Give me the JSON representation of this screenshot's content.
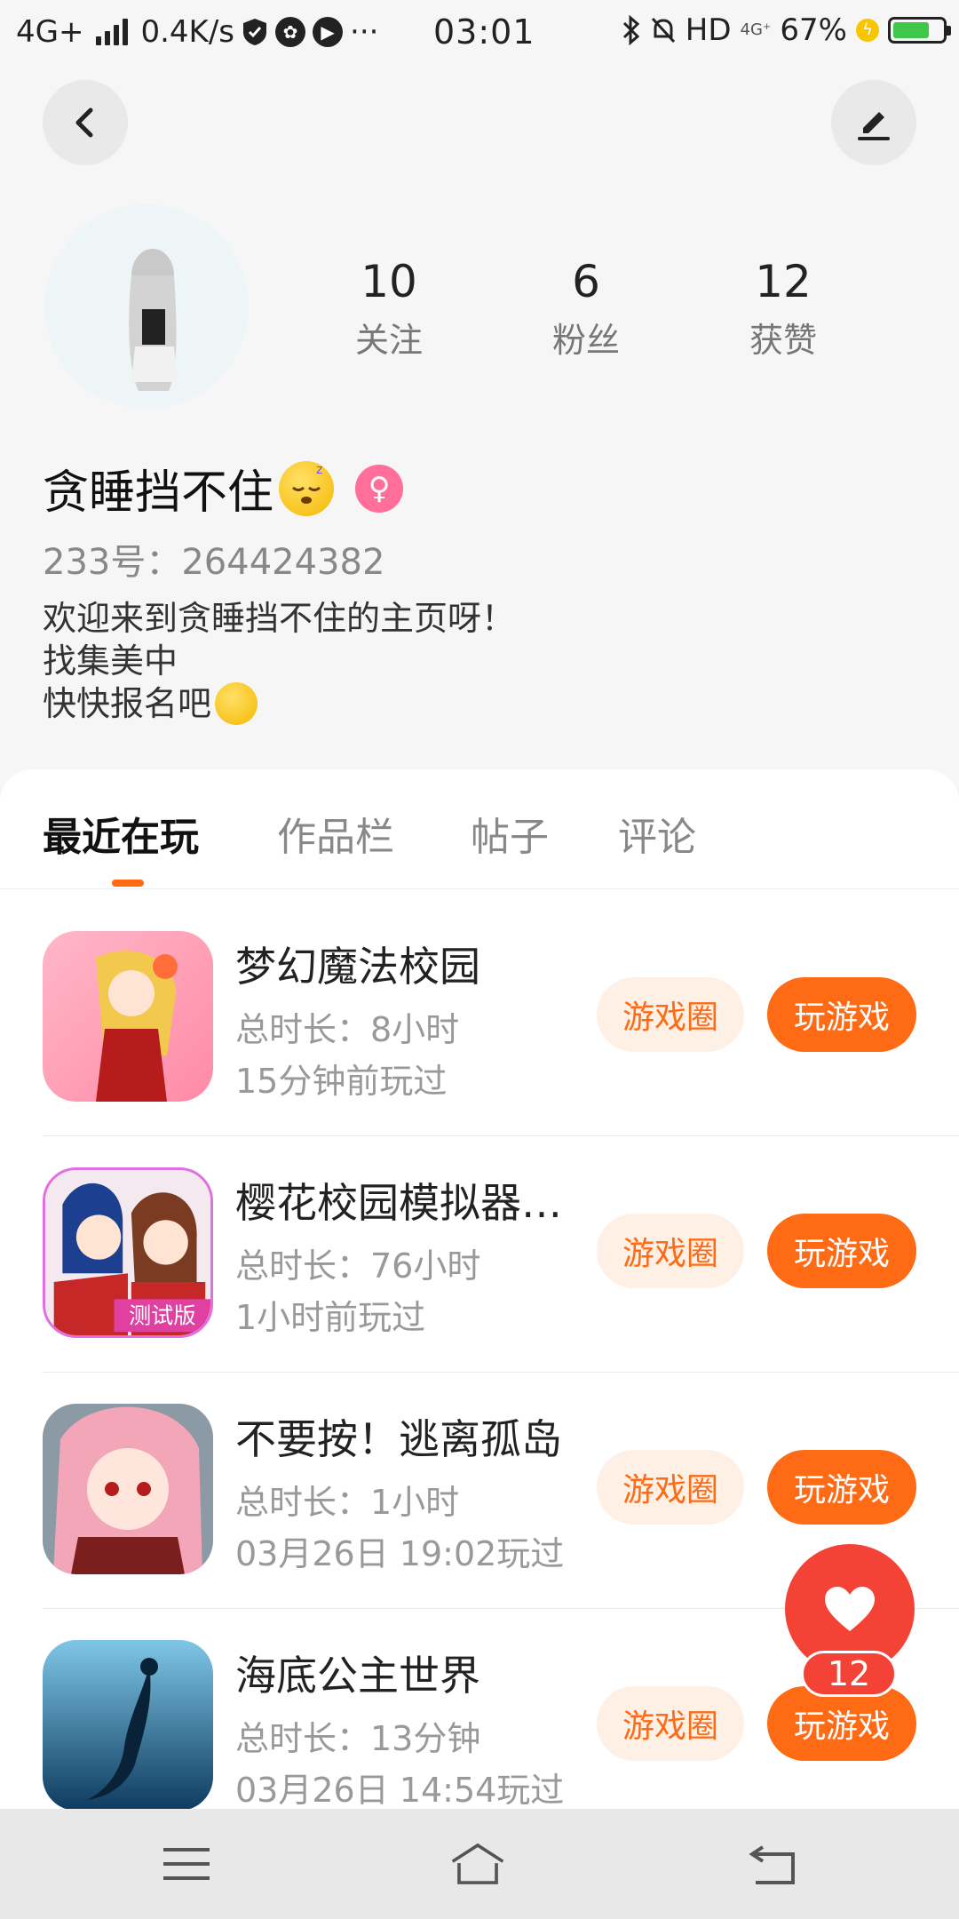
{
  "status_bar": {
    "network": "4G+",
    "speed": "0.4K/s",
    "more": "···",
    "time": "03:01",
    "hd": "HD",
    "net_small": "4G⁺",
    "battery": "67%"
  },
  "profile": {
    "stats": [
      {
        "value": "10",
        "label": "关注"
      },
      {
        "value": "6",
        "label": "粉丝"
      },
      {
        "value": "12",
        "label": "获赞"
      }
    ],
    "nickname": "贪睡挡不住",
    "uid": "233号：264424382",
    "bio": [
      "欢迎来到贪睡挡不住的主页呀！",
      "找集美中",
      "快快报名吧"
    ]
  },
  "tabs": [
    {
      "label": "最近在玩",
      "active": true
    },
    {
      "label": "作品栏"
    },
    {
      "label": "帖子"
    },
    {
      "label": "评论"
    }
  ],
  "games": [
    {
      "name": "梦幻魔法校园",
      "duration": "总时长：8小时",
      "last_played": "15分钟前玩过",
      "circle_label": "游戏圈",
      "play_label": "玩游戏"
    },
    {
      "name": "樱花校园模拟器…",
      "duration": "总时长：76小时",
      "last_played": "1小时前玩过",
      "circle_label": "游戏圈",
      "play_label": "玩游戏",
      "icon_badge": "测试版"
    },
    {
      "name": "不要按！逃离孤岛",
      "duration": "总时长：1小时",
      "last_played": "03月26日 19:02玩过",
      "circle_label": "游戏圈",
      "play_label": "玩游戏"
    },
    {
      "name": "海底公主世界",
      "duration": "总时长：13分钟",
      "last_played": "03月26日 14:54玩过",
      "circle_label": "游戏圈",
      "play_label": "玩游戏"
    }
  ],
  "like": {
    "count": "12"
  },
  "colors": {
    "accent": "#ff6a14",
    "like": "#f44336",
    "circle_bg": "#fff0e6"
  }
}
